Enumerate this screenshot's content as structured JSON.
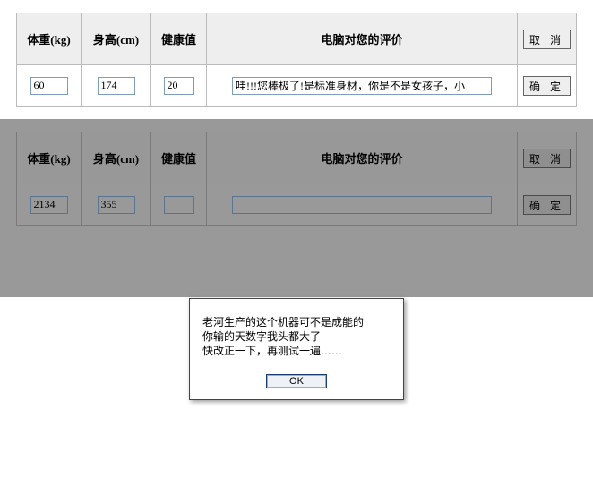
{
  "headers": {
    "weight": "体重(kg)",
    "height": "身高(cm)",
    "health": "健康值",
    "eval": "电脑对您的评价",
    "cancel": "取 消",
    "confirm": "确 定"
  },
  "row1": {
    "weight": "60",
    "height": "174",
    "health": "20",
    "eval": "哇!!!您棒极了!是标准身材，你是不是女孩子，小"
  },
  "row2": {
    "weight": "2134",
    "height": "355",
    "health": "",
    "eval": ""
  },
  "dialog": {
    "line1": "老河生产的这个机器可不是成能的",
    "line2": "你输的天数字我头都大了",
    "line3": "快改正一下，再测试一遍……",
    "ok": "OK"
  }
}
